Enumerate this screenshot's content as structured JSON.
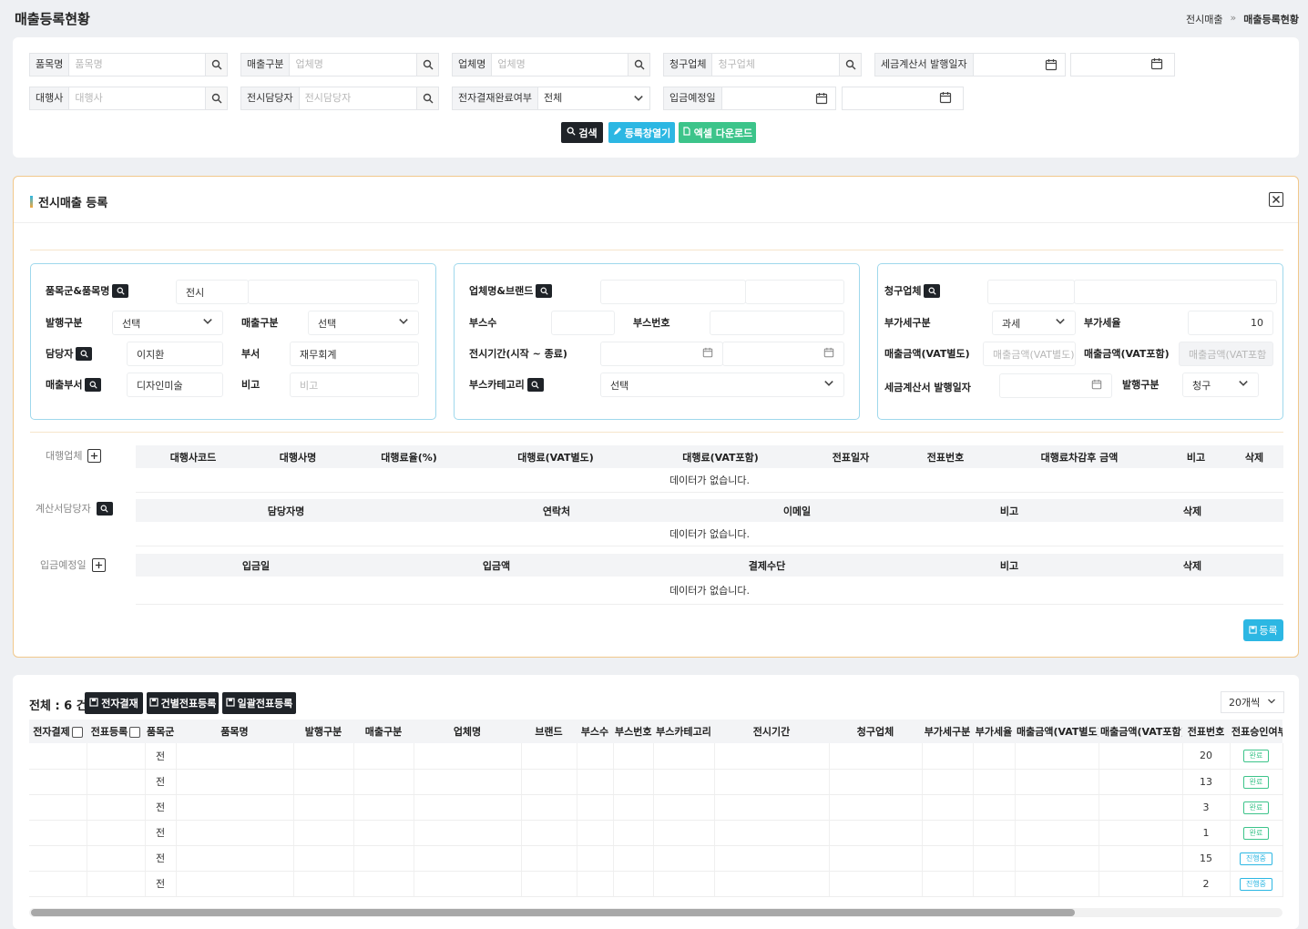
{
  "header": {
    "title": "매출등록현황",
    "breadcrumb": [
      "전시매출",
      "매출등록현황"
    ]
  },
  "search": {
    "fields": [
      {
        "label": "품목명",
        "placeholder": "품목명"
      },
      {
        "label": "매출구분",
        "placeholder": "업체명"
      },
      {
        "label": "업체명",
        "placeholder": "업체명"
      },
      {
        "label": "청구업체",
        "placeholder": "청구업체"
      },
      {
        "label": "대행사",
        "placeholder": "대행사"
      },
      {
        "label": "전시담당자",
        "placeholder": "전시담당자"
      }
    ],
    "tax_date_label": "세금계산서 발행일자",
    "ecomplete_label": "전자결재완료여부",
    "ecomplete_value": "전체",
    "deposit_label": "입금예정일",
    "buttons": {
      "search": "검색",
      "open": "등록창열기",
      "excel": "엑셀 다운로드"
    }
  },
  "register": {
    "title": "전시매출 등록",
    "box1": {
      "item_label": "품목군&품목명",
      "item_value": "전시",
      "issue_label": "발행구분",
      "issue_value": "선택",
      "sales_type_label": "매출구분",
      "sales_type_value": "선택",
      "manager_label": "담당자",
      "manager_value": "이지환",
      "dept_label": "부서",
      "dept_value": "재무회계",
      "sales_dept_label": "매출부서",
      "sales_dept_value": "디자인미술",
      "note_label": "비고",
      "note_placeholder": "비고"
    },
    "box2": {
      "company_label": "업체명&브랜드",
      "booth_count_label": "부스수",
      "booth_no_label": "부스번호",
      "period_label": "전시기간(시작 ~ 종료)",
      "booth_cat_label": "부스카테고리",
      "booth_cat_value": "선택"
    },
    "box3": {
      "bill_label": "청구업체",
      "vat_type_label": "부가세구분",
      "vat_type_value": "과세",
      "vat_rate_label": "부가세율",
      "vat_rate_value": "10",
      "amt_ex_label": "매출금액(VAT별도)",
      "amt_ex_placeholder": "매출금액(VAT별도)",
      "amt_in_label": "매출금액(VAT포함)",
      "amt_in_placeholder": "매출금액(VAT포함",
      "tax_date_label": "세금계산서 발행일자",
      "issue_label": "발행구분",
      "issue_value": "청구"
    },
    "agency": {
      "label": "대행업체",
      "columns": [
        "대행사코드",
        "대행사명",
        "대행료율(%)",
        "대행료(VAT별도)",
        "대행료(VAT포함)",
        "전표일자",
        "전표번호",
        "대행료차감후 금액",
        "비고",
        "삭제"
      ]
    },
    "bill_manager": {
      "label": "계산서담당자",
      "columns": [
        "담당자명",
        "연락처",
        "이메일",
        "비고",
        "삭제"
      ]
    },
    "deposit": {
      "label": "입금예정일",
      "columns": [
        "입금일",
        "입금액",
        "결제수단",
        "비고",
        "삭제"
      ]
    },
    "empty_text": "데이터가 없습니다.",
    "submit_label": "등록"
  },
  "list": {
    "total": "전체 : 6 건",
    "buttons": [
      "전자결재",
      "건별전표등록",
      "일괄전표등록"
    ],
    "page_size": "20개씩",
    "columns": [
      "전자결제",
      "전표등록",
      "품목군",
      "품목명",
      "발행구분",
      "매출구분",
      "업체명",
      "브랜드",
      "부스수",
      "부스번호",
      "부스카테고리",
      "전시기간",
      "청구업체",
      "부가세구분",
      "부가세율",
      "매출금액(VAT별도)",
      "매출금액(VAT포함)",
      "전표번호",
      "전표승인여부"
    ],
    "rows": [
      {
        "group": "전",
        "voucher": "20",
        "status": "완료"
      },
      {
        "group": "전",
        "voucher": "13",
        "status": "완료"
      },
      {
        "group": "전",
        "voucher": "3",
        "status": "완료"
      },
      {
        "group": "전",
        "voucher": "1",
        "status": "완료"
      },
      {
        "group": "전",
        "voucher": "15",
        "status": "진행중"
      },
      {
        "group": "전",
        "voucher": "2",
        "status": "진행중"
      }
    ]
  }
}
